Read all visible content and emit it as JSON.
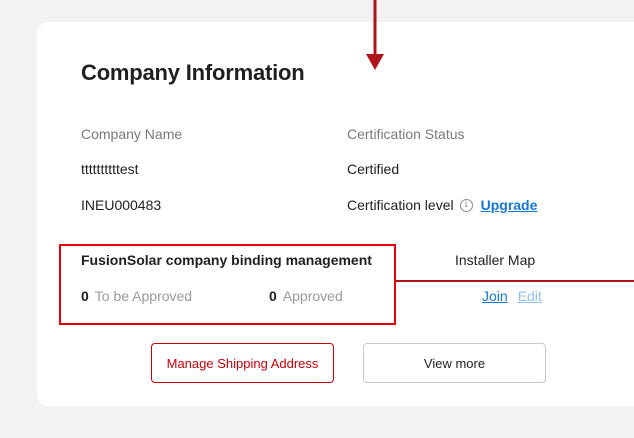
{
  "card": {
    "title": "Company Information",
    "company_name_label": "Company Name",
    "company_name_value": "ttttttttttest",
    "company_id": "INEU000483",
    "cert_status_label": "Certification Status",
    "cert_status_value": "Certified",
    "cert_level_label": "Certification level",
    "upgrade_link": "Upgrade",
    "binding": {
      "title": "FusionSolar company binding management",
      "to_be_approved_count": "0",
      "to_be_approved_label": "To be Approved",
      "approved_count": "0",
      "approved_label": "Approved"
    },
    "installer_map": {
      "title": "Installer Map",
      "join_link": "Join",
      "edit_link": "Edit"
    },
    "buttons": {
      "manage_shipping": "Manage Shipping Address",
      "view_more": "View more"
    }
  },
  "colors": {
    "accent_red": "#c7000b",
    "link_blue": "#1677d2",
    "annotation_red": "#e0000f"
  },
  "icons": [
    "info-icon",
    "annotation-arrow-down",
    "annotation-pointer-line"
  ]
}
